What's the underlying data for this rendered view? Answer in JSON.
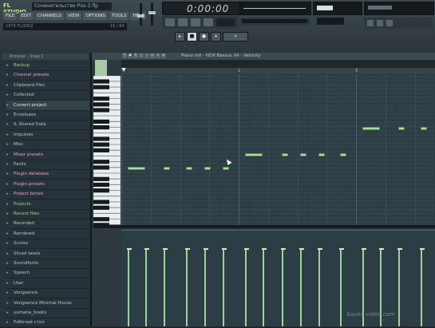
{
  "app": {
    "logo": "FL STUDIO",
    "window_title": "Сочинительство Рох-2.flp",
    "menus": [
      "FILE",
      "EDIT",
      "CHANNELS",
      "VIEW",
      "OPTIONS",
      "TOOLS",
      "HELP"
    ],
    "hint": "1979 FL/2002",
    "hint_counter": "15 / 64"
  },
  "transport": {
    "time": "0:00:00",
    "buttons": [
      "▸",
      "■",
      "●",
      "⏸",
      "»"
    ]
  },
  "browser": {
    "title": "Browser - Snap 1",
    "items": [
      {
        "label": "Backup",
        "style": "green"
      },
      {
        "label": "Channel presets",
        "style": "pink"
      },
      {
        "label": "Clipboard files",
        "style": "normal"
      },
      {
        "label": "Collected",
        "style": "normal"
      },
      {
        "label": "Current project",
        "style": "selected"
      },
      {
        "label": "Envelopes",
        "style": "normal"
      },
      {
        "label": "IL Shared Data",
        "style": "normal"
      },
      {
        "label": "Impulses",
        "style": "normal"
      },
      {
        "label": "Misc",
        "style": "normal"
      },
      {
        "label": "Mixer presets",
        "style": "pink"
      },
      {
        "label": "Packs",
        "style": "normal"
      },
      {
        "label": "Plugin database",
        "style": "pink"
      },
      {
        "label": "Plugin presets",
        "style": "pink"
      },
      {
        "label": "Project bones",
        "style": "pink"
      },
      {
        "label": "Projects",
        "style": "green"
      },
      {
        "label": "Recent files",
        "style": "green"
      },
      {
        "label": "Recorded",
        "style": "normal"
      },
      {
        "label": "Rendered",
        "style": "normal"
      },
      {
        "label": "Scores",
        "style": "normal"
      },
      {
        "label": "Sliced beats",
        "style": "normal"
      },
      {
        "label": "Soundfonts",
        "style": "normal"
      },
      {
        "label": "Speech",
        "style": "normal"
      },
      {
        "label": "User",
        "style": "normal"
      },
      {
        "label": "Vengeance",
        "style": "normal"
      },
      {
        "label": "Vengeance Minimal House",
        "style": "normal"
      },
      {
        "label": "yamaha_books",
        "style": "normal"
      },
      {
        "label": "Рабочий стол",
        "style": "normal"
      }
    ]
  },
  "piano_roll": {
    "title": "Piano roll - HDX Bassus 04 - Velocity",
    "bar_numbers": [
      "2",
      "3"
    ],
    "tool_icons": [
      "pencil-icon",
      "brush-icon",
      "delete-icon",
      "mute-icon",
      "slice-icon",
      "select-icon",
      "zoom-icon",
      "play-icon"
    ]
  },
  "colors": {
    "note": "#a7dfa1",
    "grid_bg": "#31414a",
    "accent_green": "#9dd28a",
    "accent_pink": "#e5a1c3"
  },
  "watermark": "Sound-video.com"
}
